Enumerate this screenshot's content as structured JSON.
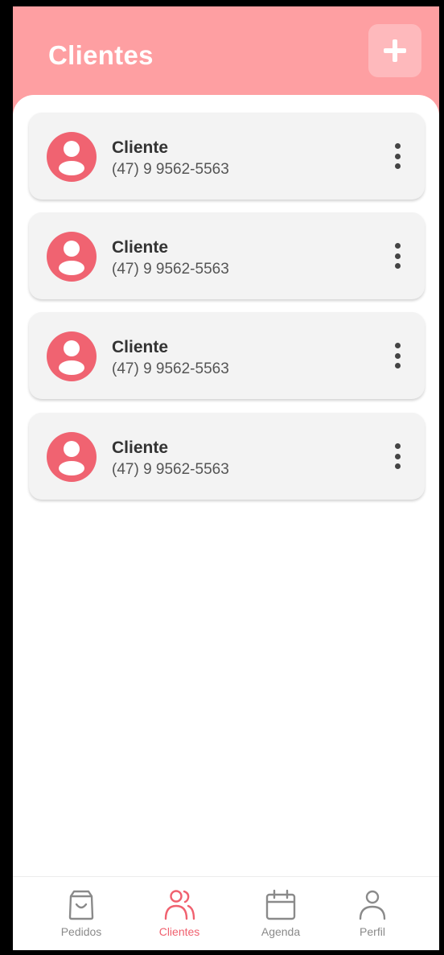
{
  "header": {
    "title": "Clientes",
    "add_icon": "plus-icon"
  },
  "clients": [
    {
      "name": "Cliente",
      "phone": "(47) 9 9562-5563"
    },
    {
      "name": "Cliente",
      "phone": "(47) 9 9562-5563"
    },
    {
      "name": "Cliente",
      "phone": "(47) 9 9562-5563"
    },
    {
      "name": "Cliente",
      "phone": "(47) 9 9562-5563"
    }
  ],
  "nav": {
    "items": [
      {
        "label": "Pedidos",
        "icon": "shopping-bag-icon"
      },
      {
        "label": "Clientes",
        "icon": "users-icon",
        "active": true
      },
      {
        "label": "Agenda",
        "icon": "calendar-icon"
      },
      {
        "label": "Perfil",
        "icon": "user-icon"
      }
    ]
  },
  "colors": {
    "header_bg": "#fe9fa2",
    "accent": "#f06371",
    "card_bg": "#f3f3f3"
  }
}
